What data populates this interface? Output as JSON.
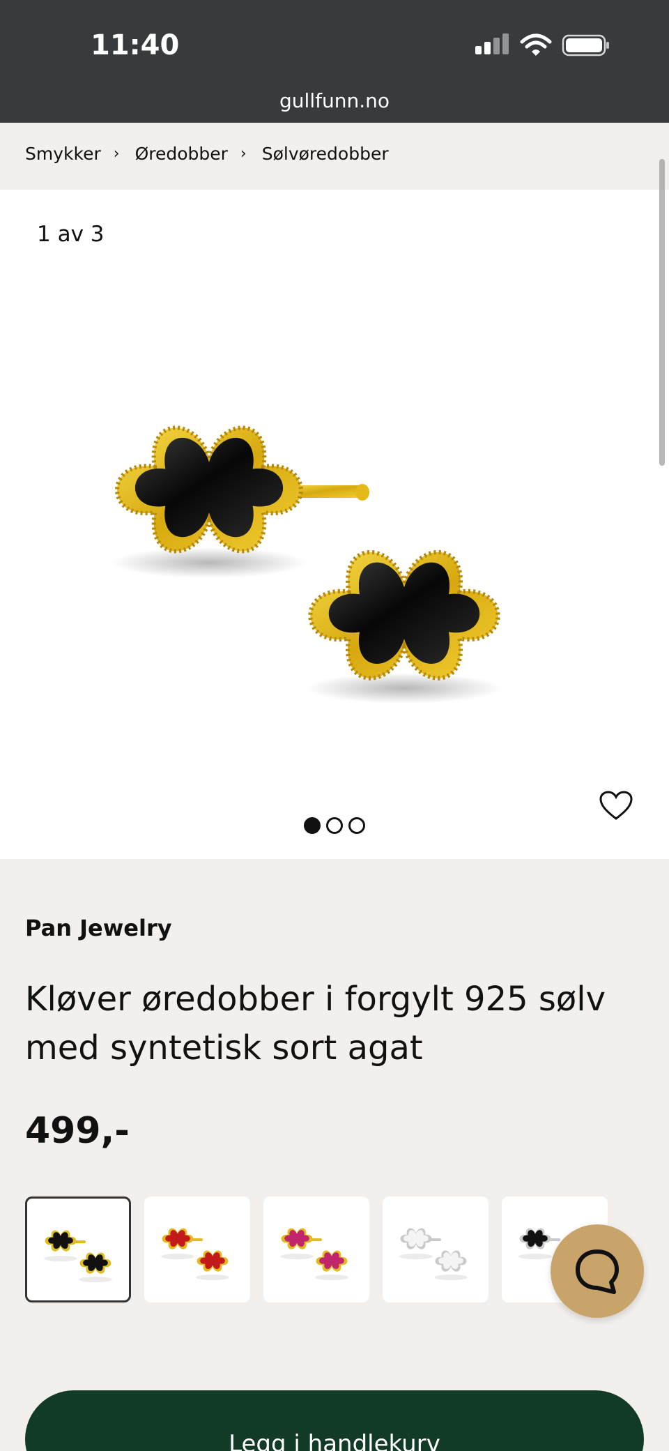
{
  "status_bar": {
    "time": "11:40"
  },
  "browser": {
    "url": "gullfunn.no"
  },
  "breadcrumb": {
    "items": [
      "Smykker",
      "Øredobber",
      "Sølvøredobber"
    ],
    "separator": "›"
  },
  "gallery": {
    "counter": "1 av 3",
    "current_index": 1,
    "total": 3
  },
  "product": {
    "brand": "Pan Jewelry",
    "title": "Kløver øredobber i forgylt 925 sølv med syntetisk sort agat",
    "price": "499,-"
  },
  "variants": [
    {
      "metal": "#e2bb1e",
      "stone": "#111111",
      "selected": true
    },
    {
      "metal": "#e2bb1e",
      "stone": "#c21a1a",
      "selected": false
    },
    {
      "metal": "#e2bb1e",
      "stone": "#c1256b",
      "selected": false
    },
    {
      "metal": "#c9c9c9",
      "stone": "#f4f4f4",
      "selected": false
    },
    {
      "metal": "#c9c9c9",
      "stone": "#111111",
      "selected": false
    }
  ],
  "actions": {
    "add_to_cart": "Legg i handlekurv"
  },
  "icons": {
    "heart": "heart-icon",
    "chat": "chat-icon",
    "signal": "signal-icon",
    "wifi": "wifi-icon",
    "battery": "battery-icon"
  },
  "colors": {
    "topbar": "#383b3d",
    "page_bg": "#f2efec",
    "cta_bg": "#123b27",
    "chat_bg": "#c9a46a",
    "gold": "#e2bb1e"
  }
}
